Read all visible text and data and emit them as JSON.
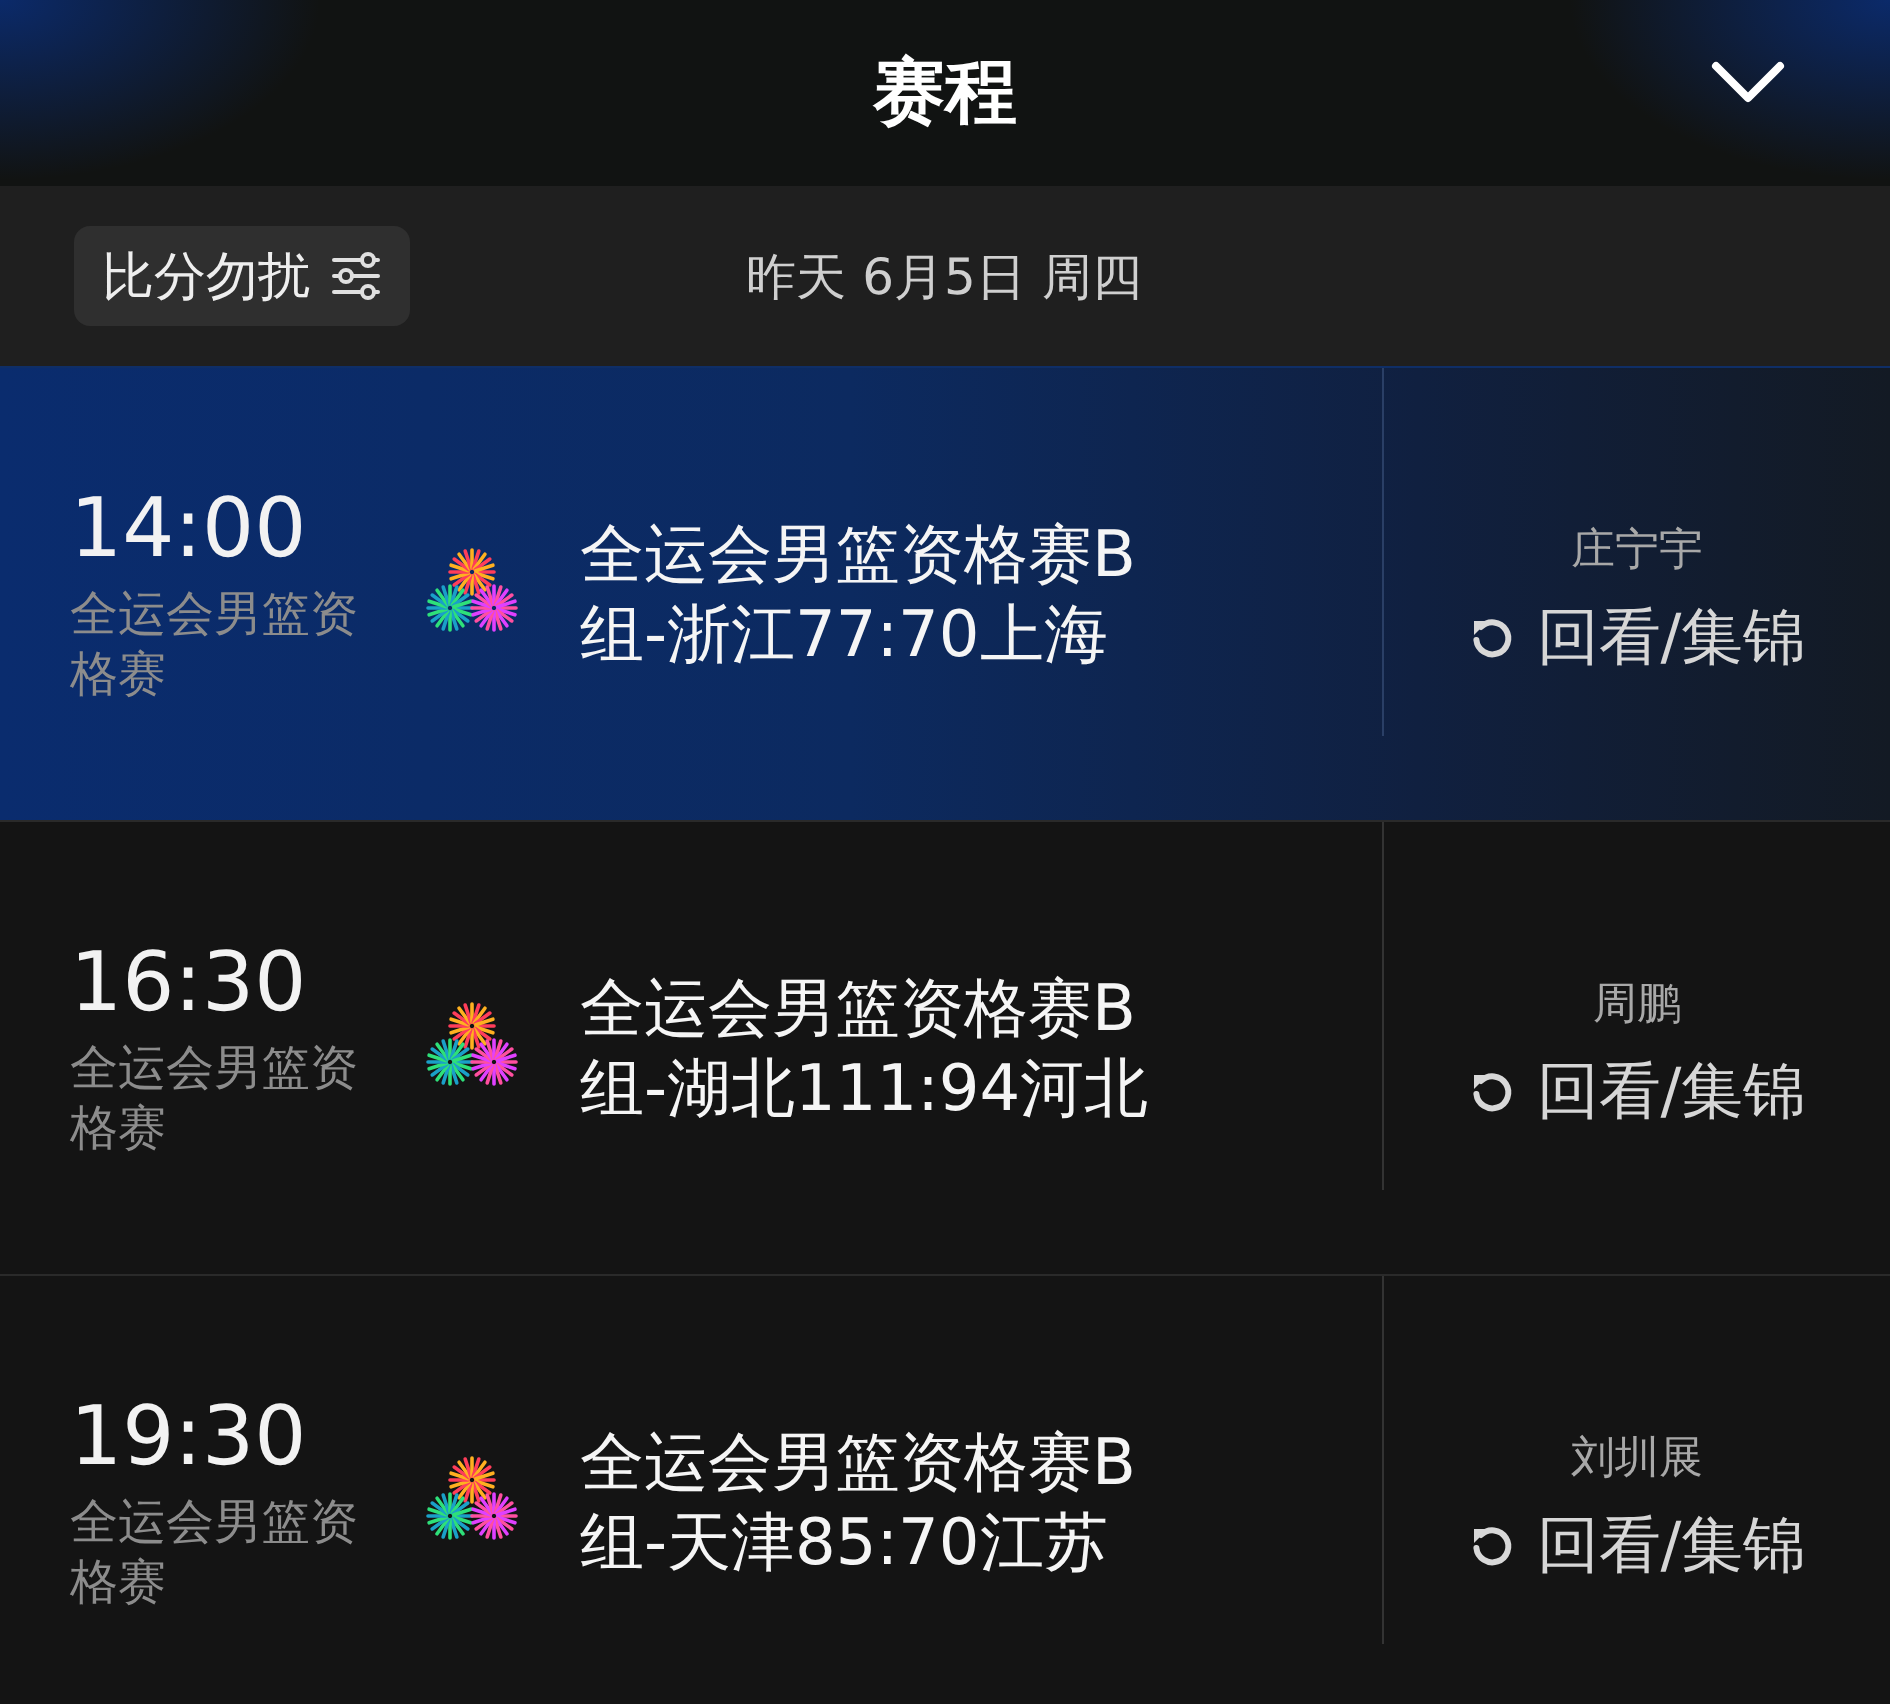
{
  "header": {
    "title": "赛程"
  },
  "filter_bar": {
    "toggle_label": "比分勿扰",
    "date": "昨天 6月5日 周四"
  },
  "matches": [
    {
      "time": "14:00",
      "category": "全运会男篮资格赛",
      "title": "全运会男篮资格赛B组-浙江77:70上海",
      "commentator": "庄宁宇",
      "replay_label": "回看/集锦",
      "selected": true
    },
    {
      "time": "16:30",
      "category": "全运会男篮资格赛",
      "title": "全运会男篮资格赛B组-湖北111:94河北",
      "commentator": "周鹏",
      "replay_label": "回看/集锦",
      "selected": false
    },
    {
      "time": "19:30",
      "category": "全运会男篮资格赛",
      "title": "全运会男篮资格赛B组-天津85:70江苏",
      "commentator": "刘圳展",
      "replay_label": "回看/集锦",
      "selected": false
    }
  ]
}
